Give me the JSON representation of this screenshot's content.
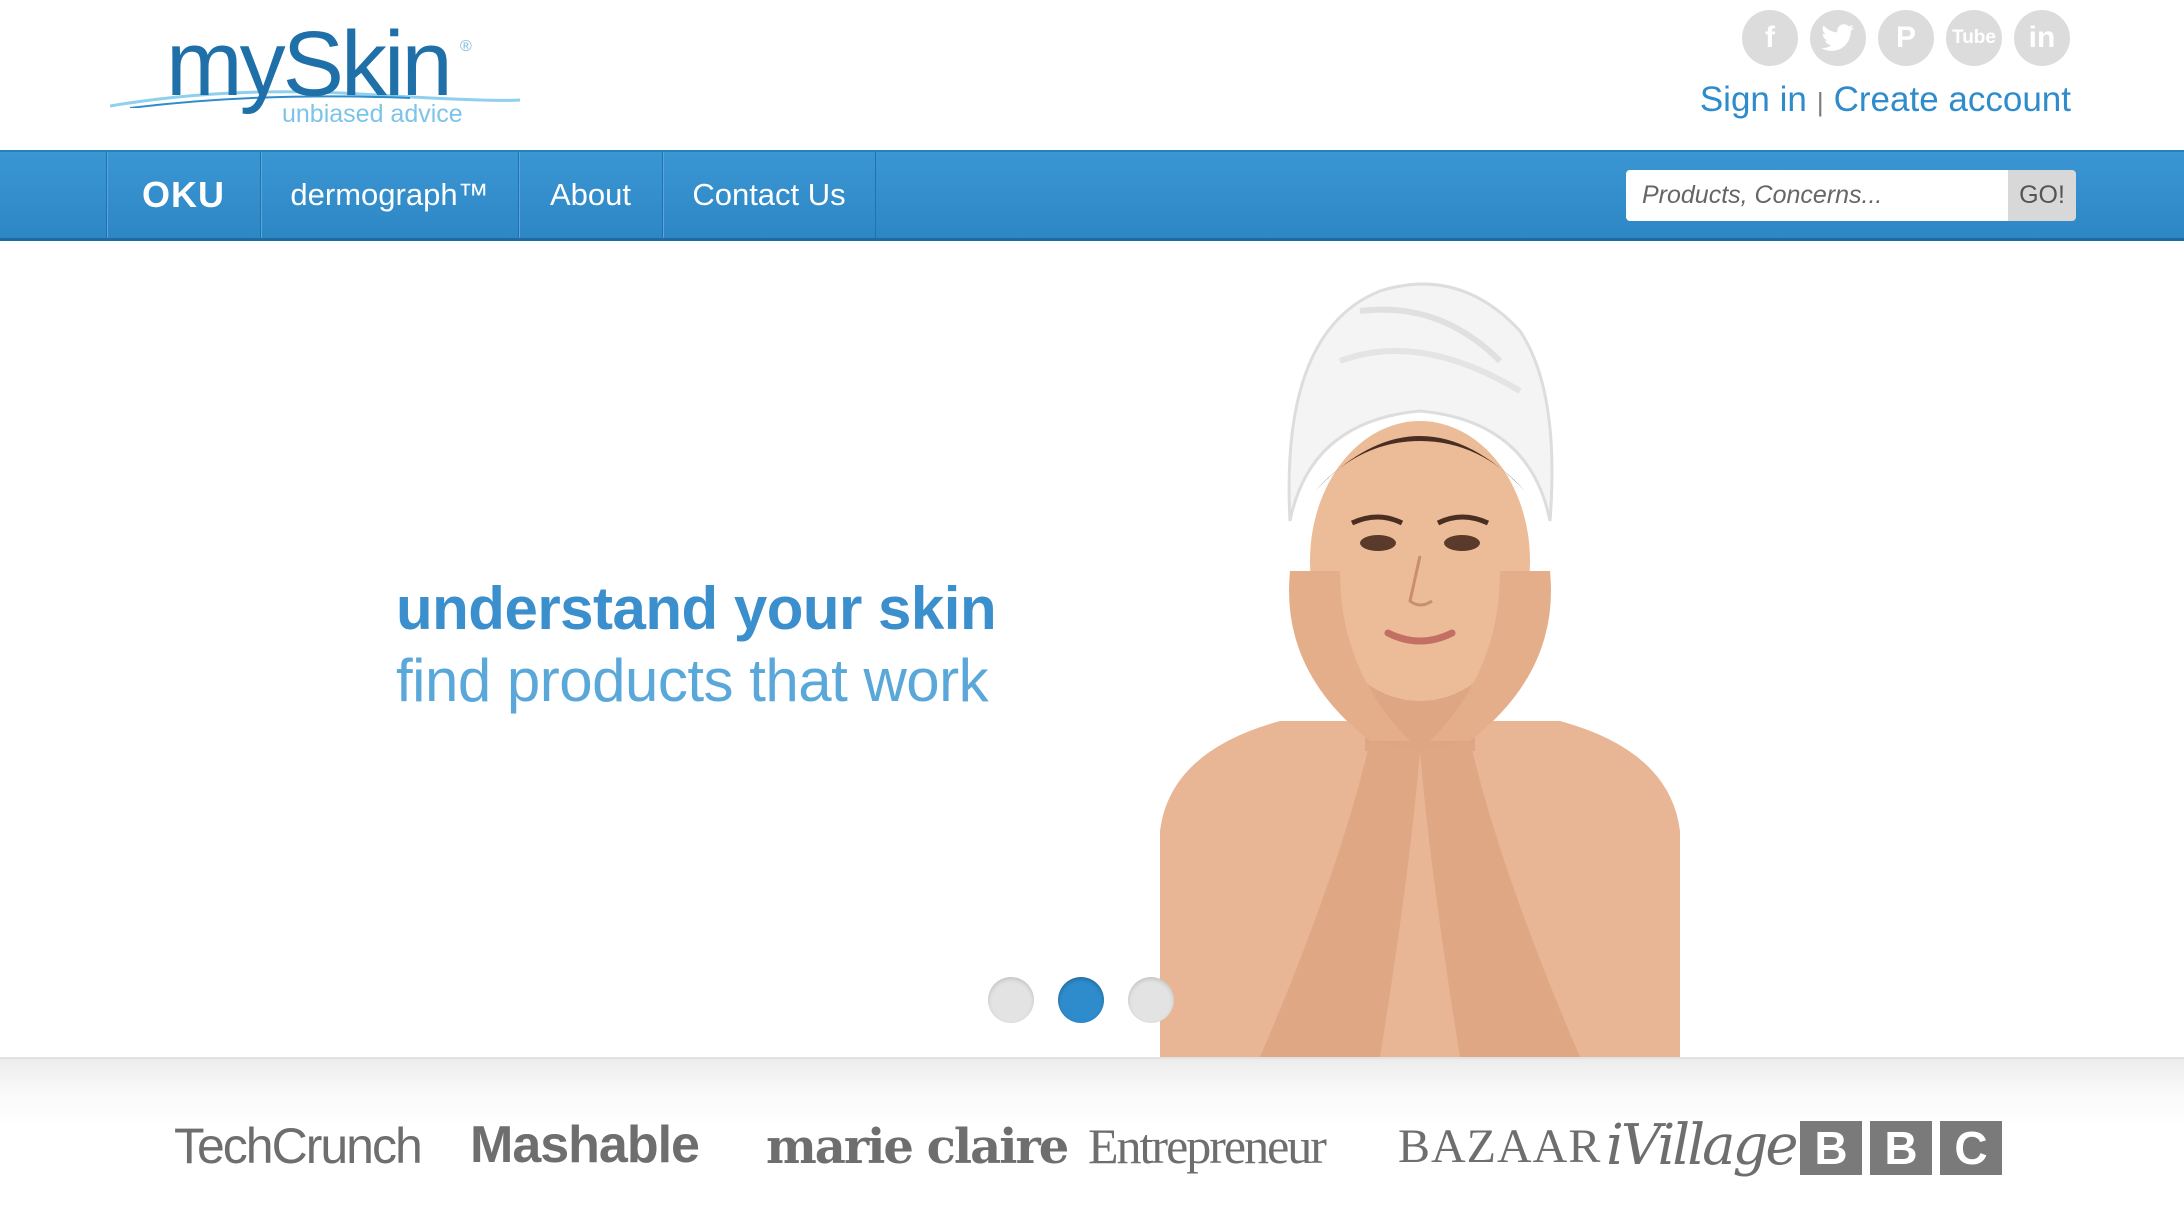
{
  "brand": {
    "name": "mySkin",
    "tagline": "unbiased advice",
    "registered": "®",
    "color": "#1f6fa8"
  },
  "social": [
    {
      "name": "facebook-icon",
      "glyph": "f"
    },
    {
      "name": "twitter-icon",
      "glyph": ""
    },
    {
      "name": "pinterest-icon",
      "glyph": "P"
    },
    {
      "name": "youtube-icon",
      "glyph": "Tube"
    },
    {
      "name": "linkedin-icon",
      "glyph": "in"
    }
  ],
  "account": {
    "sign_in": "Sign in",
    "separator": "|",
    "create": "Create account"
  },
  "nav": {
    "oku": "OKU",
    "items": [
      {
        "label": "dermograph™"
      },
      {
        "label": "About"
      },
      {
        "label": "Contact Us"
      }
    ],
    "search_placeholder": "Products, Concerns...",
    "search_button": "GO!",
    "color": "#3a96d2"
  },
  "hero": {
    "headline_1": "understand your skin",
    "headline_2": "find products that work",
    "slides": 3,
    "active_slide": 2
  },
  "press": {
    "logos": [
      "TechCrunch",
      "Mashable",
      "marie claire",
      "Entrepreneur",
      "BAZAAR",
      "iVillage",
      "BBC"
    ],
    "bbc_letters": [
      "B",
      "B",
      "C"
    ]
  }
}
